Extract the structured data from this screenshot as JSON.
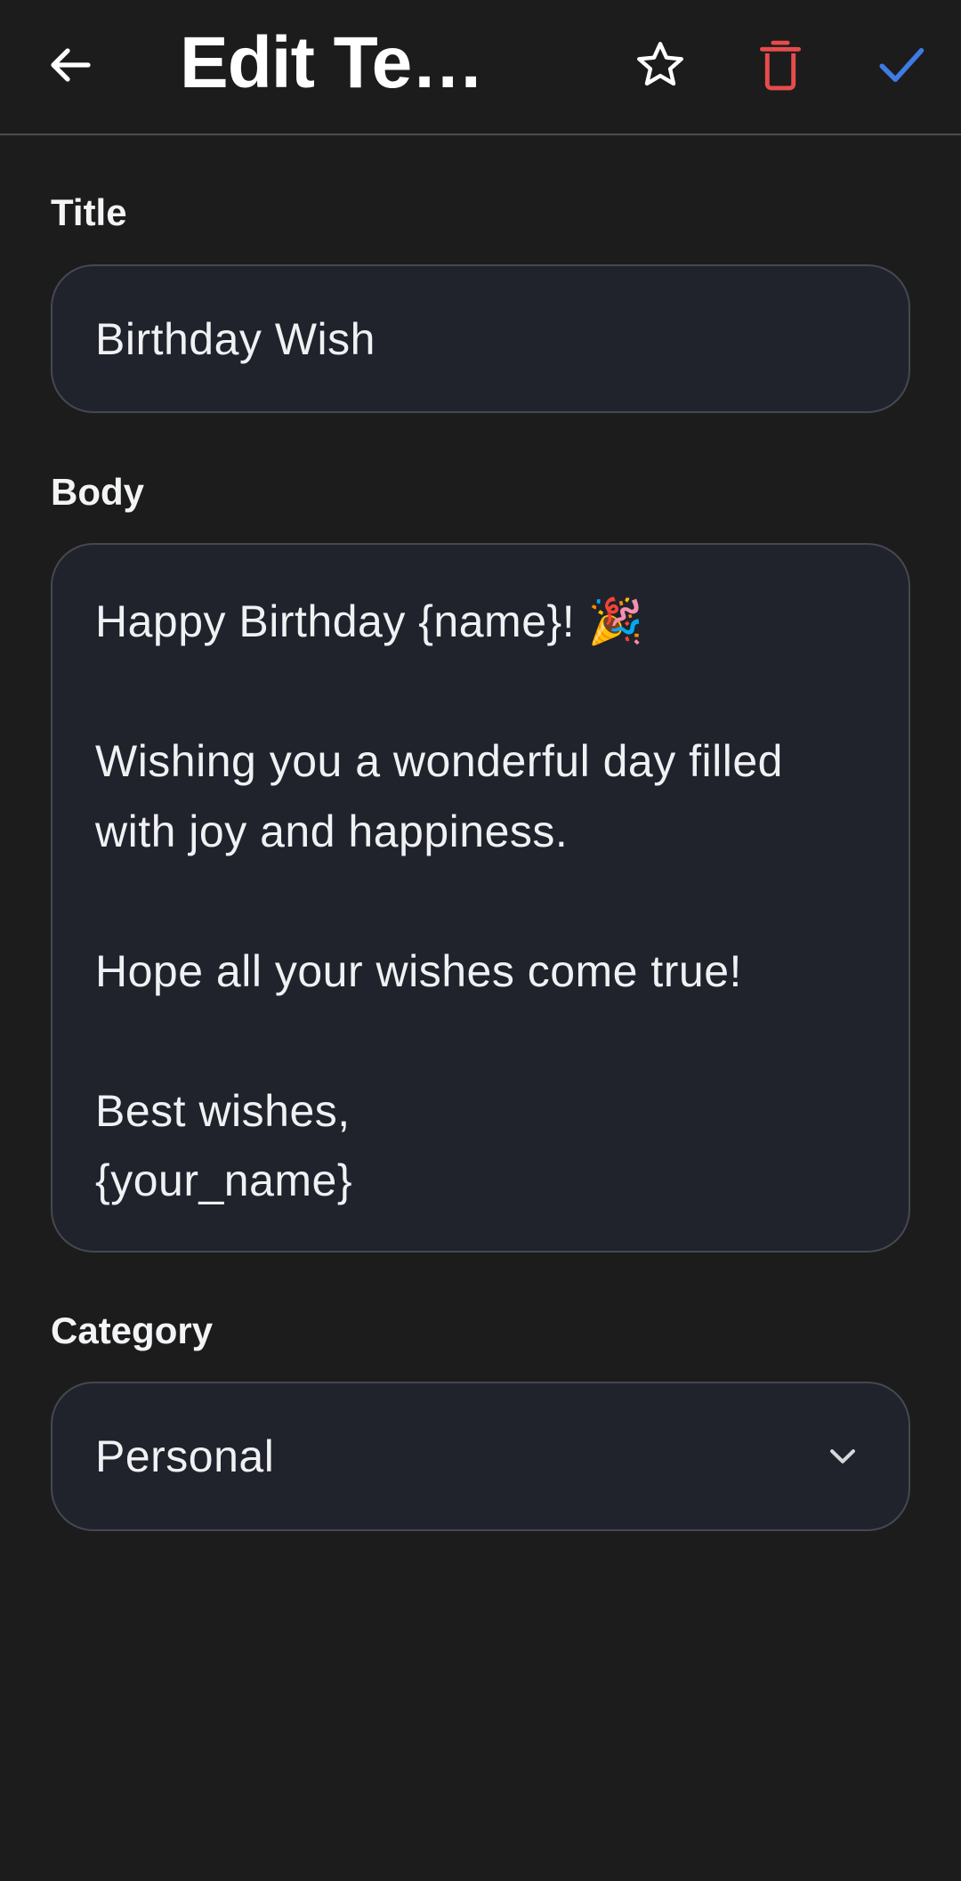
{
  "header": {
    "title": "Edit Template",
    "back_icon": "arrow-left-icon",
    "favorite_icon": "star-outline-icon",
    "delete_icon": "trash-icon",
    "save_icon": "check-icon"
  },
  "form": {
    "title": {
      "label": "Title",
      "value": "Birthday Wish"
    },
    "body": {
      "label": "Body",
      "value": "Happy Birthday {name}! 🎉\n\nWishing you a wonderful day filled with joy and happiness.\n\nHope all your wishes come true!\n\nBest wishes,\n{your_name}"
    },
    "category": {
      "label": "Category",
      "value": "Personal",
      "icon": "chevron-down-icon"
    }
  },
  "colors": {
    "background": "#1c1c1c",
    "field_background": "#20232c",
    "delete_accent": "#e74c4c",
    "save_accent": "#3f7be6"
  }
}
